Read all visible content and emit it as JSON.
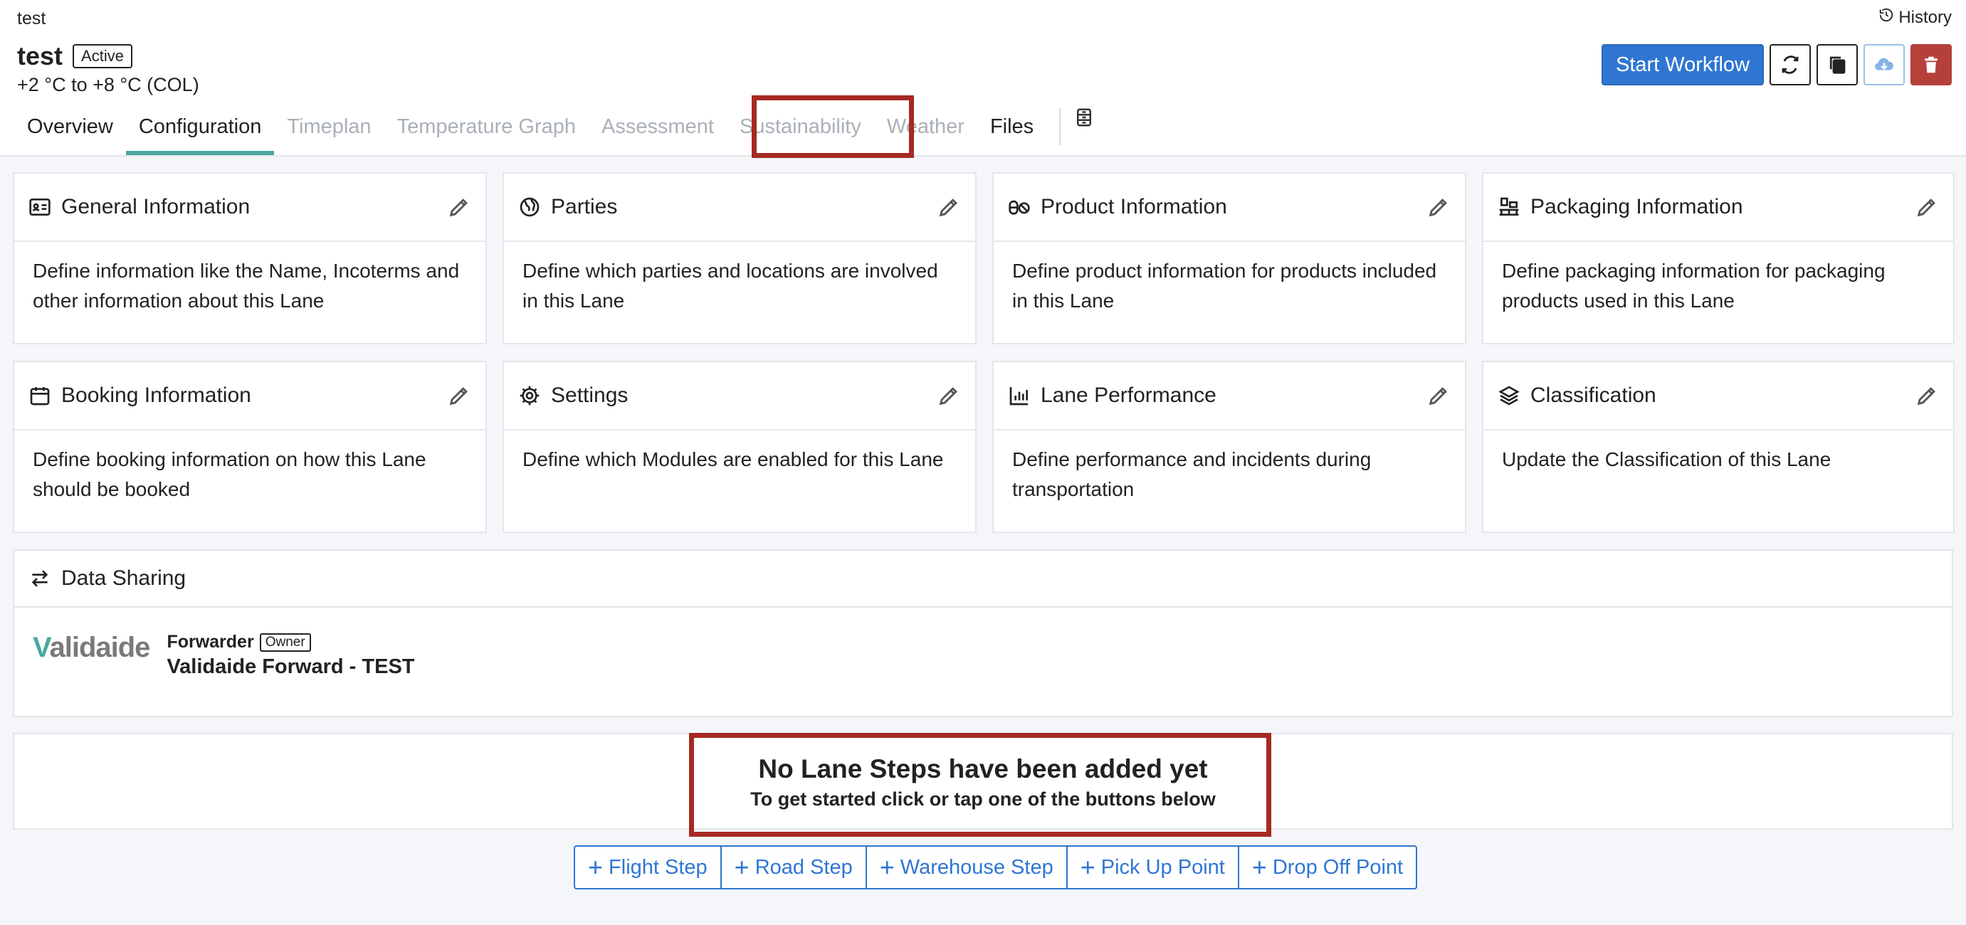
{
  "breadcrumb": "test",
  "history_label": "History",
  "lane": {
    "title": "test",
    "status": "Active",
    "temperature": "+2 °C to +8 °C (COL)"
  },
  "actions": {
    "start_workflow": "Start Workflow"
  },
  "tabs": [
    {
      "label": "Overview"
    },
    {
      "label": "Configuration"
    },
    {
      "label": "Timeplan"
    },
    {
      "label": "Temperature Graph"
    },
    {
      "label": "Assessment"
    },
    {
      "label": "Sustainability"
    },
    {
      "label": "Weather"
    },
    {
      "label": "Files"
    }
  ],
  "cards": [
    {
      "title": "General Information",
      "desc": "Define information like the Name, Incoterms and other information about this Lane",
      "icon": "id-card-icon"
    },
    {
      "title": "Parties",
      "desc": "Define which parties and locations are involved in this Lane",
      "icon": "globe-icon"
    },
    {
      "title": "Product Information",
      "desc": "Define product information for products included in this Lane",
      "icon": "pills-icon"
    },
    {
      "title": "Packaging Information",
      "desc": "Define packaging information for packaging products used in this Lane",
      "icon": "pallet-icon"
    },
    {
      "title": "Booking Information",
      "desc": "Define booking information on how this Lane should be booked",
      "icon": "calendar-icon"
    },
    {
      "title": "Settings",
      "desc": "Define which Modules are enabled for this Lane",
      "icon": "gear-icon"
    },
    {
      "title": "Lane Performance",
      "desc": "Define performance and incidents during transportation",
      "icon": "chart-icon"
    },
    {
      "title": "Classification",
      "desc": "Update the Classification of this Lane",
      "icon": "layers-icon"
    }
  ],
  "data_sharing": {
    "title": "Data Sharing",
    "logo_text": "Validaide",
    "role": "Forwarder",
    "owner_tag": "Owner",
    "org_name": "Validaide Forward - TEST"
  },
  "empty_state": {
    "title": "No Lane Steps have been added yet",
    "subtitle": "To get started click or tap one of the buttons below"
  },
  "step_buttons": [
    {
      "label": "Flight Step"
    },
    {
      "label": "Road Step"
    },
    {
      "label": "Warehouse Step"
    },
    {
      "label": "Pick Up Point"
    },
    {
      "label": "Drop Off Point"
    }
  ],
  "colors": {
    "primary": "#2f76d2",
    "danger": "#b5403a",
    "accent_tab": "#4aa8a0",
    "highlight": "#a52a22"
  }
}
